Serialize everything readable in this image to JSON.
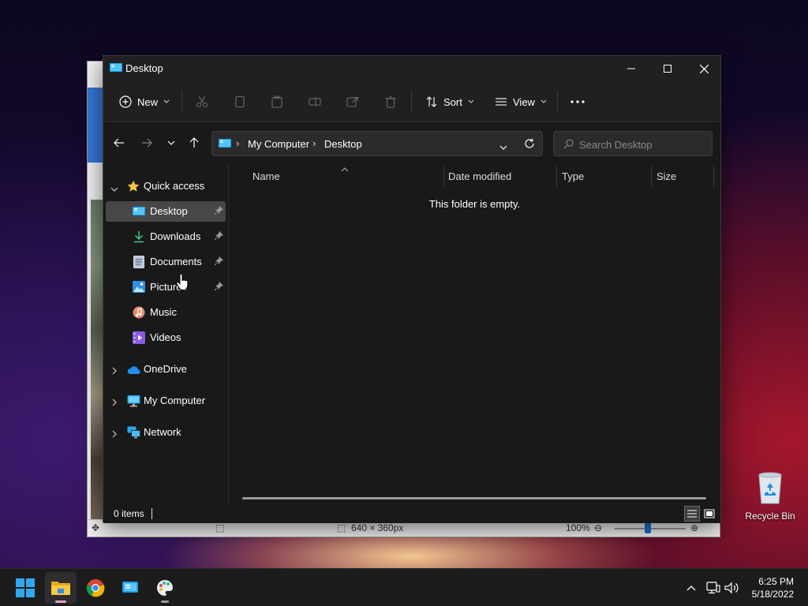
{
  "background_window": {
    "statusbar": {
      "dimensions": "640 × 360px",
      "zoom": "100%"
    }
  },
  "explorer": {
    "title": "Desktop",
    "toolbar": {
      "new_label": "New",
      "sort_label": "Sort",
      "view_label": "View"
    },
    "address": {
      "breadcrumb": [
        "My Computer",
        "Desktop"
      ]
    },
    "search": {
      "placeholder": "Search Desktop"
    },
    "sidebar": {
      "quick_access": "Quick access",
      "items": [
        {
          "label": "Desktop",
          "icon": "desktop-icon",
          "pinned": true,
          "selected": true
        },
        {
          "label": "Downloads",
          "icon": "download-icon",
          "pinned": true
        },
        {
          "label": "Documents",
          "icon": "documents-icon",
          "pinned": true
        },
        {
          "label": "Pictures",
          "icon": "pictures-icon",
          "pinned": true
        },
        {
          "label": "Music",
          "icon": "music-icon",
          "pinned": false
        },
        {
          "label": "Videos",
          "icon": "videos-icon",
          "pinned": false
        }
      ],
      "onedrive": "OneDrive",
      "my_computer": "My Computer",
      "network": "Network"
    },
    "columns": [
      "Name",
      "Date modified",
      "Type",
      "Size"
    ],
    "empty_message": "This folder is empty.",
    "status": {
      "items": "0 items"
    }
  },
  "desktop": {
    "recycle_bin": "Recycle Bin"
  },
  "taskbar": {
    "apps": [
      "start-icon",
      "file-explorer-icon",
      "chrome-icon",
      "remote-desktop-icon",
      "paint-icon"
    ],
    "clock": {
      "time": "6:25 PM",
      "date": "5/18/2022"
    }
  },
  "colors": {
    "window_bg": "#191919",
    "chrome_bg": "#202020",
    "selection": "#474747",
    "accent": "#4cc2ff"
  }
}
